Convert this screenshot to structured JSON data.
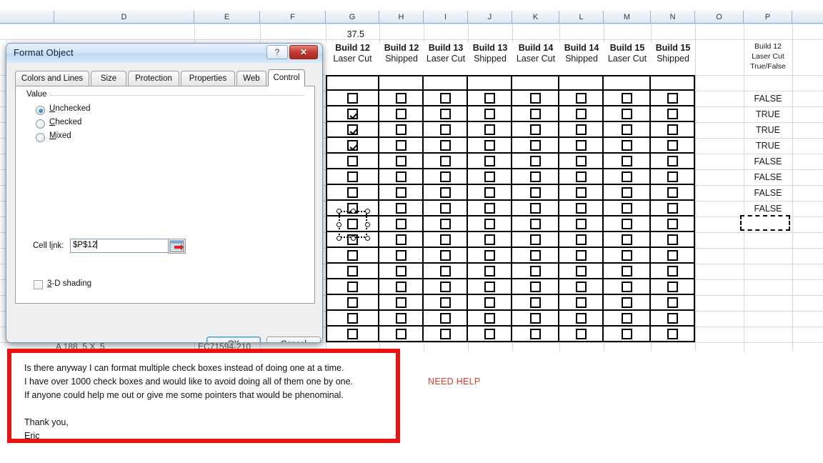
{
  "spreadsheet": {
    "column_headers": [
      "D",
      "E",
      "F",
      "G",
      "H",
      "I",
      "J",
      "K",
      "L",
      "M",
      "N",
      "O",
      "P"
    ],
    "value_cell_g": "37.5",
    "build_headers": [
      {
        "build": "Build 12",
        "stage": "Laser Cut"
      },
      {
        "build": "Build 12",
        "stage": "Shipped"
      },
      {
        "build": "Build 13",
        "stage": "Laser Cut"
      },
      {
        "build": "Build 13",
        "stage": "Shipped"
      },
      {
        "build": "Build 14",
        "stage": "Laser Cut"
      },
      {
        "build": "Build 14",
        "stage": "Shipped"
      },
      {
        "build": "Build 15",
        "stage": "Laser Cut"
      },
      {
        "build": "Build 15",
        "stage": "Shipped"
      }
    ],
    "p_header": {
      "line1": "Build 12",
      "line2": "Laser Cut",
      "line3": "True/False"
    },
    "p_values": [
      "FALSE",
      "TRUE",
      "TRUE",
      "TRUE",
      "FALSE",
      "FALSE",
      "FALSE",
      "FALSE"
    ],
    "checkbox_rows": [
      [
        false,
        false,
        false,
        false,
        false,
        false,
        false,
        false
      ],
      [
        true,
        false,
        false,
        false,
        false,
        false,
        false,
        false
      ],
      [
        true,
        false,
        false,
        false,
        false,
        false,
        false,
        false
      ],
      [
        true,
        false,
        false,
        false,
        false,
        false,
        false,
        false
      ],
      [
        false,
        false,
        false,
        false,
        false,
        false,
        false,
        false
      ],
      [
        false,
        false,
        false,
        false,
        false,
        false,
        false,
        false
      ],
      [
        false,
        false,
        false,
        false,
        false,
        false,
        false,
        false
      ],
      [
        false,
        false,
        false,
        false,
        false,
        false,
        false,
        false
      ],
      [
        false,
        false,
        false,
        false,
        false,
        false,
        false,
        false
      ],
      [
        false,
        false,
        false,
        false,
        false,
        false,
        false,
        false
      ],
      [
        false,
        false,
        false,
        false,
        false,
        false,
        false,
        false
      ],
      [
        false,
        false,
        false,
        false,
        false,
        false,
        false,
        false
      ],
      [
        false,
        false,
        false,
        false,
        false,
        false,
        false,
        false
      ],
      [
        false,
        false,
        false,
        false,
        false,
        false,
        false,
        false
      ],
      [
        false,
        false,
        false,
        false,
        false,
        false,
        false,
        false
      ],
      [
        false,
        false,
        false,
        false,
        false,
        false,
        false,
        false
      ]
    ],
    "obscured_row_left": "A 188  .5 X  .5",
    "obscured_row_right": "EC71594-210"
  },
  "dialog": {
    "title": "Format Object",
    "help_button": "?",
    "close_button": "✕",
    "tabs": [
      {
        "label": "Colors and Lines",
        "active": false
      },
      {
        "label": "Size",
        "active": false
      },
      {
        "label": "Protection",
        "active": false
      },
      {
        "label": "Properties",
        "active": false
      },
      {
        "label": "Web",
        "active": false
      },
      {
        "label": "Control",
        "active": true
      }
    ],
    "group_label": "Value",
    "radios": [
      {
        "label": "Unchecked",
        "underline": "U",
        "selected": true
      },
      {
        "label": "Checked",
        "underline": "C",
        "selected": false
      },
      {
        "label": "Mixed",
        "underline": "M",
        "selected": false
      }
    ],
    "cell_link_label": "Cell link:",
    "cell_link_value": "$P$12",
    "range_picker_icon": "range-picker-icon",
    "shading_label": "3-D shading",
    "shading_underline": "3",
    "shading_checked": false,
    "ok_button": "OK",
    "cancel_button": "Cancel"
  },
  "annotation": {
    "body": "Is there anyway I can format multiple check boxes instead of doing one at a time.\nI have over 1000 check boxes and would like to avoid doing all of them one by one.\nIf anyone could help me out or give me some pointers that would be phenominal.\n\nThank you,\nEric",
    "need_help": "NEED HELP",
    "box_color": "#ee1111",
    "need_help_color": "#e8392c"
  }
}
